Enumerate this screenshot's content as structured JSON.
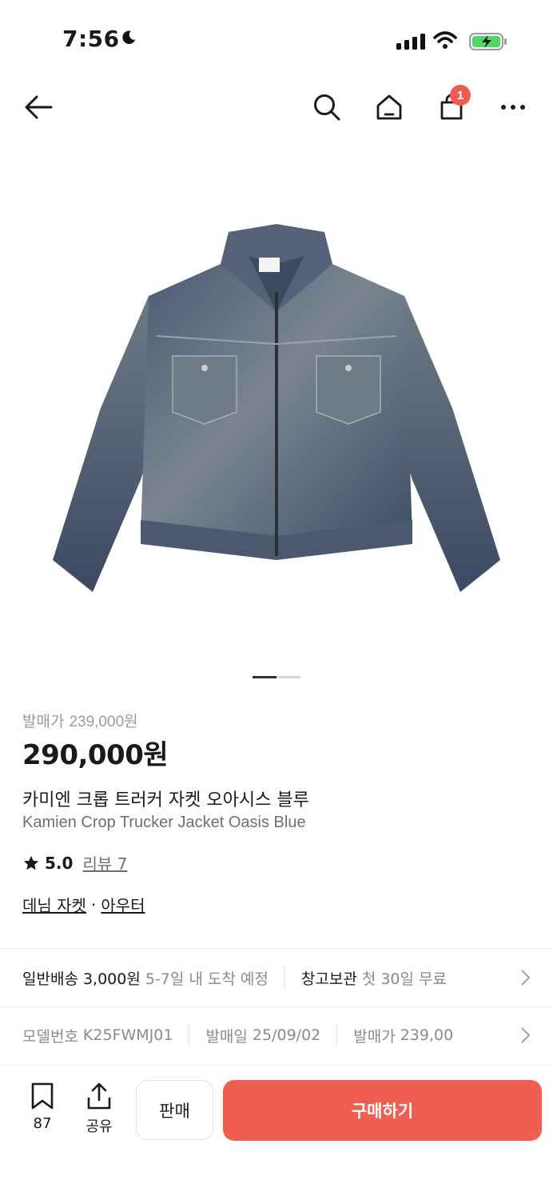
{
  "status_bar": {
    "time": "7:56",
    "icons": [
      "moon-icon",
      "cellular-signal-icon",
      "wifi-icon",
      "battery-charging-icon"
    ]
  },
  "nav": {
    "icons": [
      "back-arrow-icon",
      "search-icon",
      "home-icon",
      "cart-icon",
      "more-icon"
    ],
    "cart_badge": "1"
  },
  "product": {
    "image_alt": "denim trucker jacket",
    "carousel": {
      "current": 1,
      "total": 2
    },
    "release_price_label": "발매가",
    "release_price_value": "239,000원",
    "current_price": "290,000원",
    "title_ko": "카미엔 크롭 트러커 자켓 오아시스 블루",
    "title_en": "Kamien Crop Trucker Jacket Oasis Blue",
    "rating": "5.0",
    "reviews_label": "리뷰 7",
    "categories": [
      "데님 자켓",
      "아우터"
    ],
    "category_separator": "·"
  },
  "shipping": {
    "standard_label": "일반배송 3,000원",
    "standard_eta": "5-7일 내 도착 예정",
    "warehouse_label": "창고보관",
    "warehouse_detail": "첫 30일 무료"
  },
  "meta": {
    "model_label": "모델번호",
    "model_value": "K25FWMJ01",
    "release_date_label": "발매일",
    "release_date_value": "25/09/02",
    "release_price_label": "발매가",
    "release_price_value": "239,00"
  },
  "bottom_bar": {
    "bookmark_count": "87",
    "share_label": "공유",
    "sell_label": "판매",
    "buy_label": "구매하기"
  },
  "colors": {
    "accent": "#ef5f51",
    "badge": "#ef5b4c",
    "muted_text": "#8a8a8a"
  }
}
